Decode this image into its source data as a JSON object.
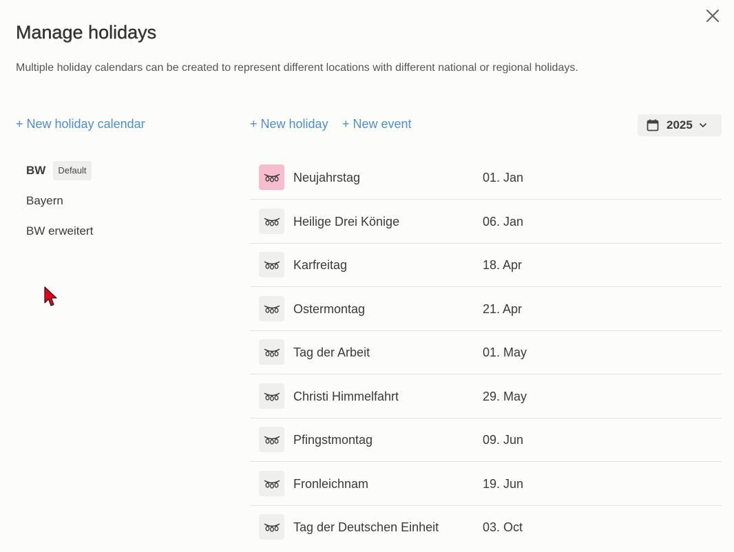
{
  "dialog": {
    "title": "Manage holidays",
    "description": "Multiple holiday calendars can be created to represent different locations with different national or regional holidays.",
    "close_icon": "close-icon"
  },
  "toolbar": {
    "new_calendar_label": "+ New holiday calendar",
    "new_holiday_label": "+ New holiday",
    "new_event_label": "+ New event",
    "year_label": "2025",
    "year_icon": "calendar-icon"
  },
  "calendars": [
    {
      "name": "BW",
      "badge": "Default",
      "active": true
    },
    {
      "name": "Bayern",
      "badge": "",
      "active": false
    },
    {
      "name": "BW erweitert",
      "badge": "",
      "active": false
    }
  ],
  "holidays": [
    {
      "name": "Neujahrstag",
      "date": "01. Jan",
      "icon": "string-lights-icon",
      "highlight": true
    },
    {
      "name": "Heilige Drei Könige",
      "date": "06. Jan",
      "icon": "string-lights-icon",
      "highlight": false
    },
    {
      "name": "Karfreitag",
      "date": "18. Apr",
      "icon": "string-lights-icon",
      "highlight": false
    },
    {
      "name": "Ostermontag",
      "date": "21. Apr",
      "icon": "string-lights-icon",
      "highlight": false
    },
    {
      "name": "Tag der Arbeit",
      "date": "01. May",
      "icon": "string-lights-icon",
      "highlight": false
    },
    {
      "name": "Christi Himmelfahrt",
      "date": "29. May",
      "icon": "string-lights-icon",
      "highlight": false
    },
    {
      "name": "Pfingstmontag",
      "date": "09. Jun",
      "icon": "string-lights-icon",
      "highlight": false
    },
    {
      "name": "Fronleichnam",
      "date": "19. Jun",
      "icon": "string-lights-icon",
      "highlight": false
    },
    {
      "name": "Tag der Deutschen Einheit",
      "date": "03. Oct",
      "icon": "string-lights-icon",
      "highlight": false
    }
  ],
  "colors": {
    "accent": "#4f8ec9",
    "highlight_icon_bg": "#f8bcd0",
    "icon_bg": "#efefed",
    "background": "#fcfcfb"
  }
}
